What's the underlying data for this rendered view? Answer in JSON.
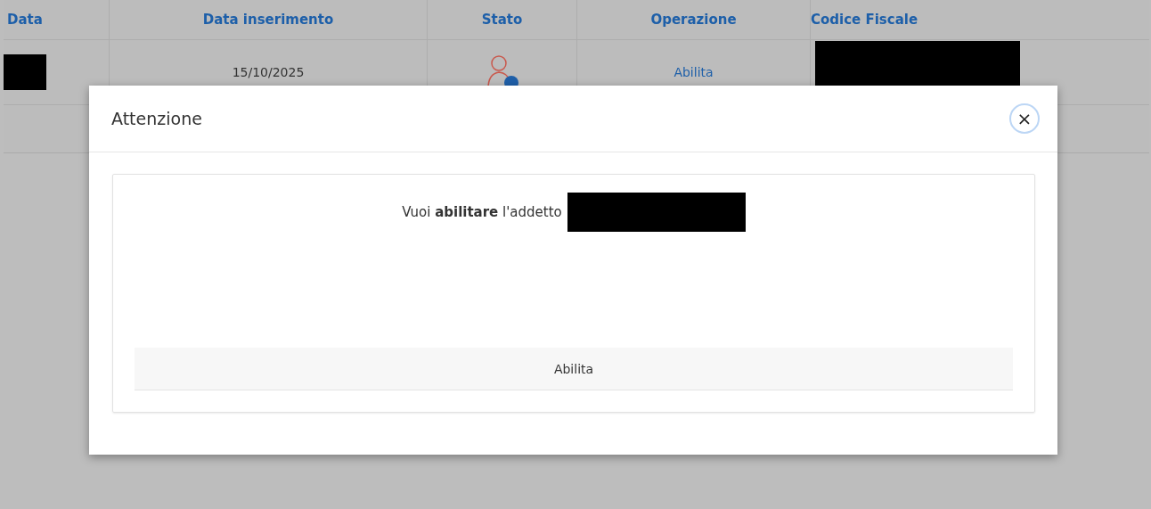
{
  "table": {
    "columns": [
      "Data",
      "Data inserimento",
      "Stato",
      "Operazione",
      "Codice Fiscale"
    ],
    "rows": [
      {
        "date": "15/10/2025",
        "operation": "Abilita"
      }
    ]
  },
  "dialog": {
    "title": "Attenzione",
    "close": "×",
    "message": "Vuoi **abilitare** l'addetto",
    "button": "Abilita"
  }
}
